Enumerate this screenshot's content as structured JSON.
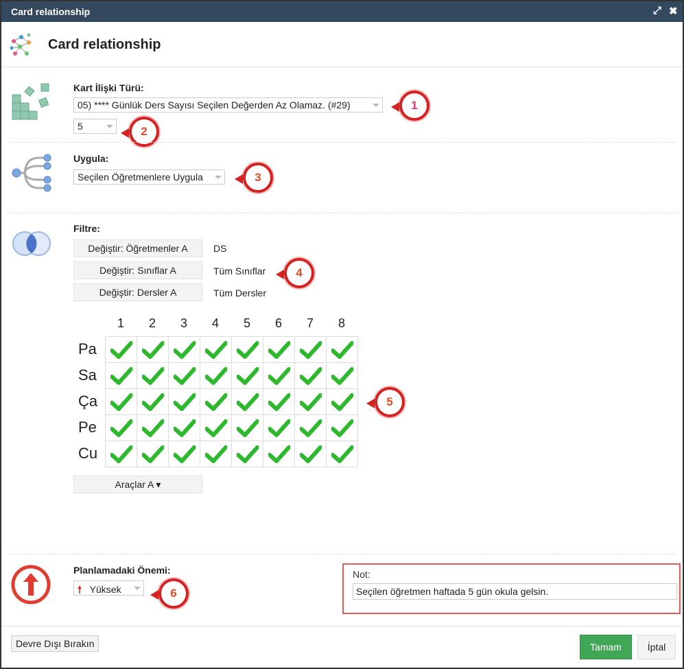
{
  "window": {
    "title": "Card relationship",
    "header_title": "Card relationship"
  },
  "relation": {
    "label": "Kart İlişki Türü:",
    "type_value": "05) **** Günlük Ders Sayısı Seçilen Değerden Az Olamaz. (#29)",
    "count_value": "5"
  },
  "apply": {
    "label": "Uygula:",
    "value": "Seçilen Öğretmenlere Uygula"
  },
  "filter": {
    "label": "Filtre:",
    "rows": [
      {
        "button": "Değiştir: Öğretmenler A",
        "value": "DS"
      },
      {
        "button": "Değiştir: Sınıflar A",
        "value": "Tüm Sınıflar"
      },
      {
        "button": "Değiştir: Dersler A",
        "value": "Tüm Dersler"
      }
    ]
  },
  "schedule": {
    "periods": [
      "1",
      "2",
      "3",
      "4",
      "5",
      "6",
      "7",
      "8"
    ],
    "days": [
      "Pa",
      "Sa",
      "Ça",
      "Pe",
      "Cu"
    ],
    "all_checked": true,
    "tools_button": "Araçlar A ▾"
  },
  "importance": {
    "label": "Planlamadaki Önemi:",
    "value": "Yüksek"
  },
  "note": {
    "label": "Not:",
    "value": "Seçilen öğretmen haftada 5 gün okula gelsin."
  },
  "footer": {
    "disable_button": "Devre Dışı Bırakın",
    "ok_button": "Tamam",
    "cancel_button": "İptal"
  },
  "callouts": [
    "1",
    "2",
    "3",
    "4",
    "5",
    "6"
  ],
  "colors": {
    "titlebar": "#34495e",
    "accent_green": "#3fa756",
    "check_green": "#2eb82e",
    "callout_red": "#d42222",
    "importance_red": "#e03c31"
  },
  "icons": {
    "header": "network-graph-icon",
    "relation": "puzzle-blocks-icon",
    "apply": "tree-branch-icon",
    "filter": "venn-diagram-icon",
    "importance": "arrow-up-circle-icon",
    "title_controls": [
      "maximize-icon",
      "close-icon"
    ]
  }
}
